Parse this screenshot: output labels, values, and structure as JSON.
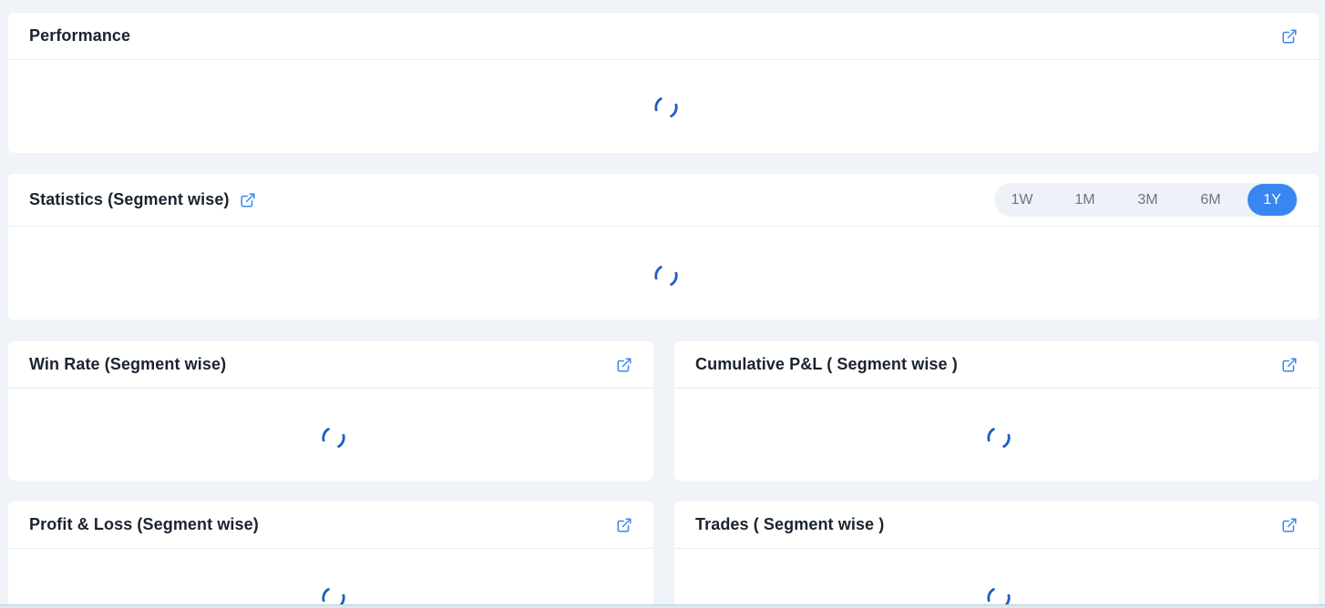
{
  "cards": {
    "performance": {
      "title": "Performance",
      "open_icon": "external-link-icon",
      "state": "loading"
    },
    "statistics": {
      "title": "Statistics (Segment wise)",
      "open_icon": "external-link-icon",
      "state": "loading",
      "ranges": [
        "1W",
        "1M",
        "3M",
        "6M",
        "1Y"
      ],
      "selected_range": "1Y"
    },
    "win_rate": {
      "title": "Win Rate (Segment wise)",
      "open_icon": "external-link-icon",
      "state": "loading"
    },
    "cumulative_pnl": {
      "title": "Cumulative P&L ( Segment wise )",
      "open_icon": "external-link-icon",
      "state": "loading"
    },
    "profit_loss": {
      "title": "Profit & Loss (Segment wise)",
      "open_icon": "external-link-icon",
      "state": "loading"
    },
    "trades": {
      "title": "Trades ( Segment wise )",
      "open_icon": "external-link-icon",
      "state": "loading"
    }
  },
  "colors": {
    "accent": "#3a86f0",
    "spinner": "#1f5fbf",
    "page_background": "#f0f3f7",
    "card_background": "#ffffff"
  }
}
